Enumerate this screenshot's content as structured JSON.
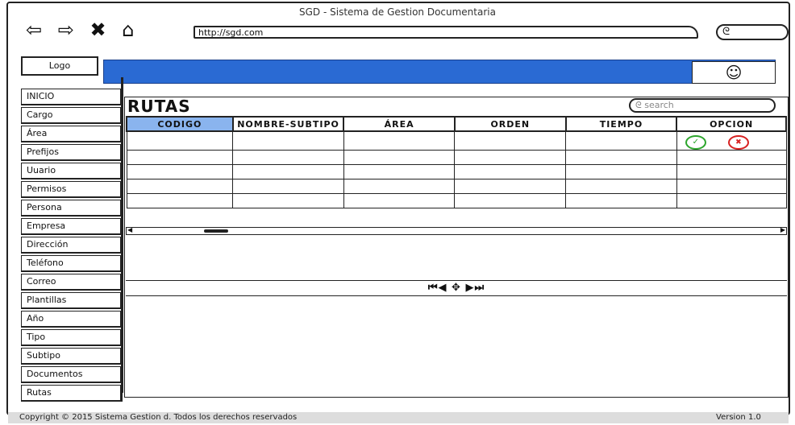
{
  "window": {
    "title": "SGD - Sistema de Gestion Documentaria",
    "url": "http://sgd.com",
    "nav_icons": "⇦ ⇨ ✖ ⌂",
    "browser_search_icon": "ᘓ"
  },
  "header": {
    "logo": "Logo",
    "accent_color": "#2a6ad3",
    "avatar_icon": "☺"
  },
  "sidebar": {
    "items": [
      "INICIO",
      "Cargo",
      "Área",
      "Prefijos",
      "Uuario",
      "Permisos",
      "Persona",
      "Empresa",
      "Dirección",
      "Teléfono",
      "Correo",
      "Plantillas",
      "Año",
      "Tipo",
      "Subtipo",
      "Documentos",
      "Rutas"
    ]
  },
  "main": {
    "title": "RUTAS",
    "search_placeholder": "ᘓ search",
    "columns": [
      "CODIGO",
      "NOMBRE-SUBTIPO",
      "ÁREA",
      "ORDEN",
      "TIEMPO",
      "OPCION"
    ],
    "row_count": 5,
    "option_icons": {
      "approve": "✓",
      "delete": "✖"
    },
    "pager": "⏮◀ ✥ ▶⏭"
  },
  "footer": {
    "copyright": "Copyright © 2015 Sistema Gestion d. Todos los derechos reservados",
    "version": "Version 1.0"
  }
}
